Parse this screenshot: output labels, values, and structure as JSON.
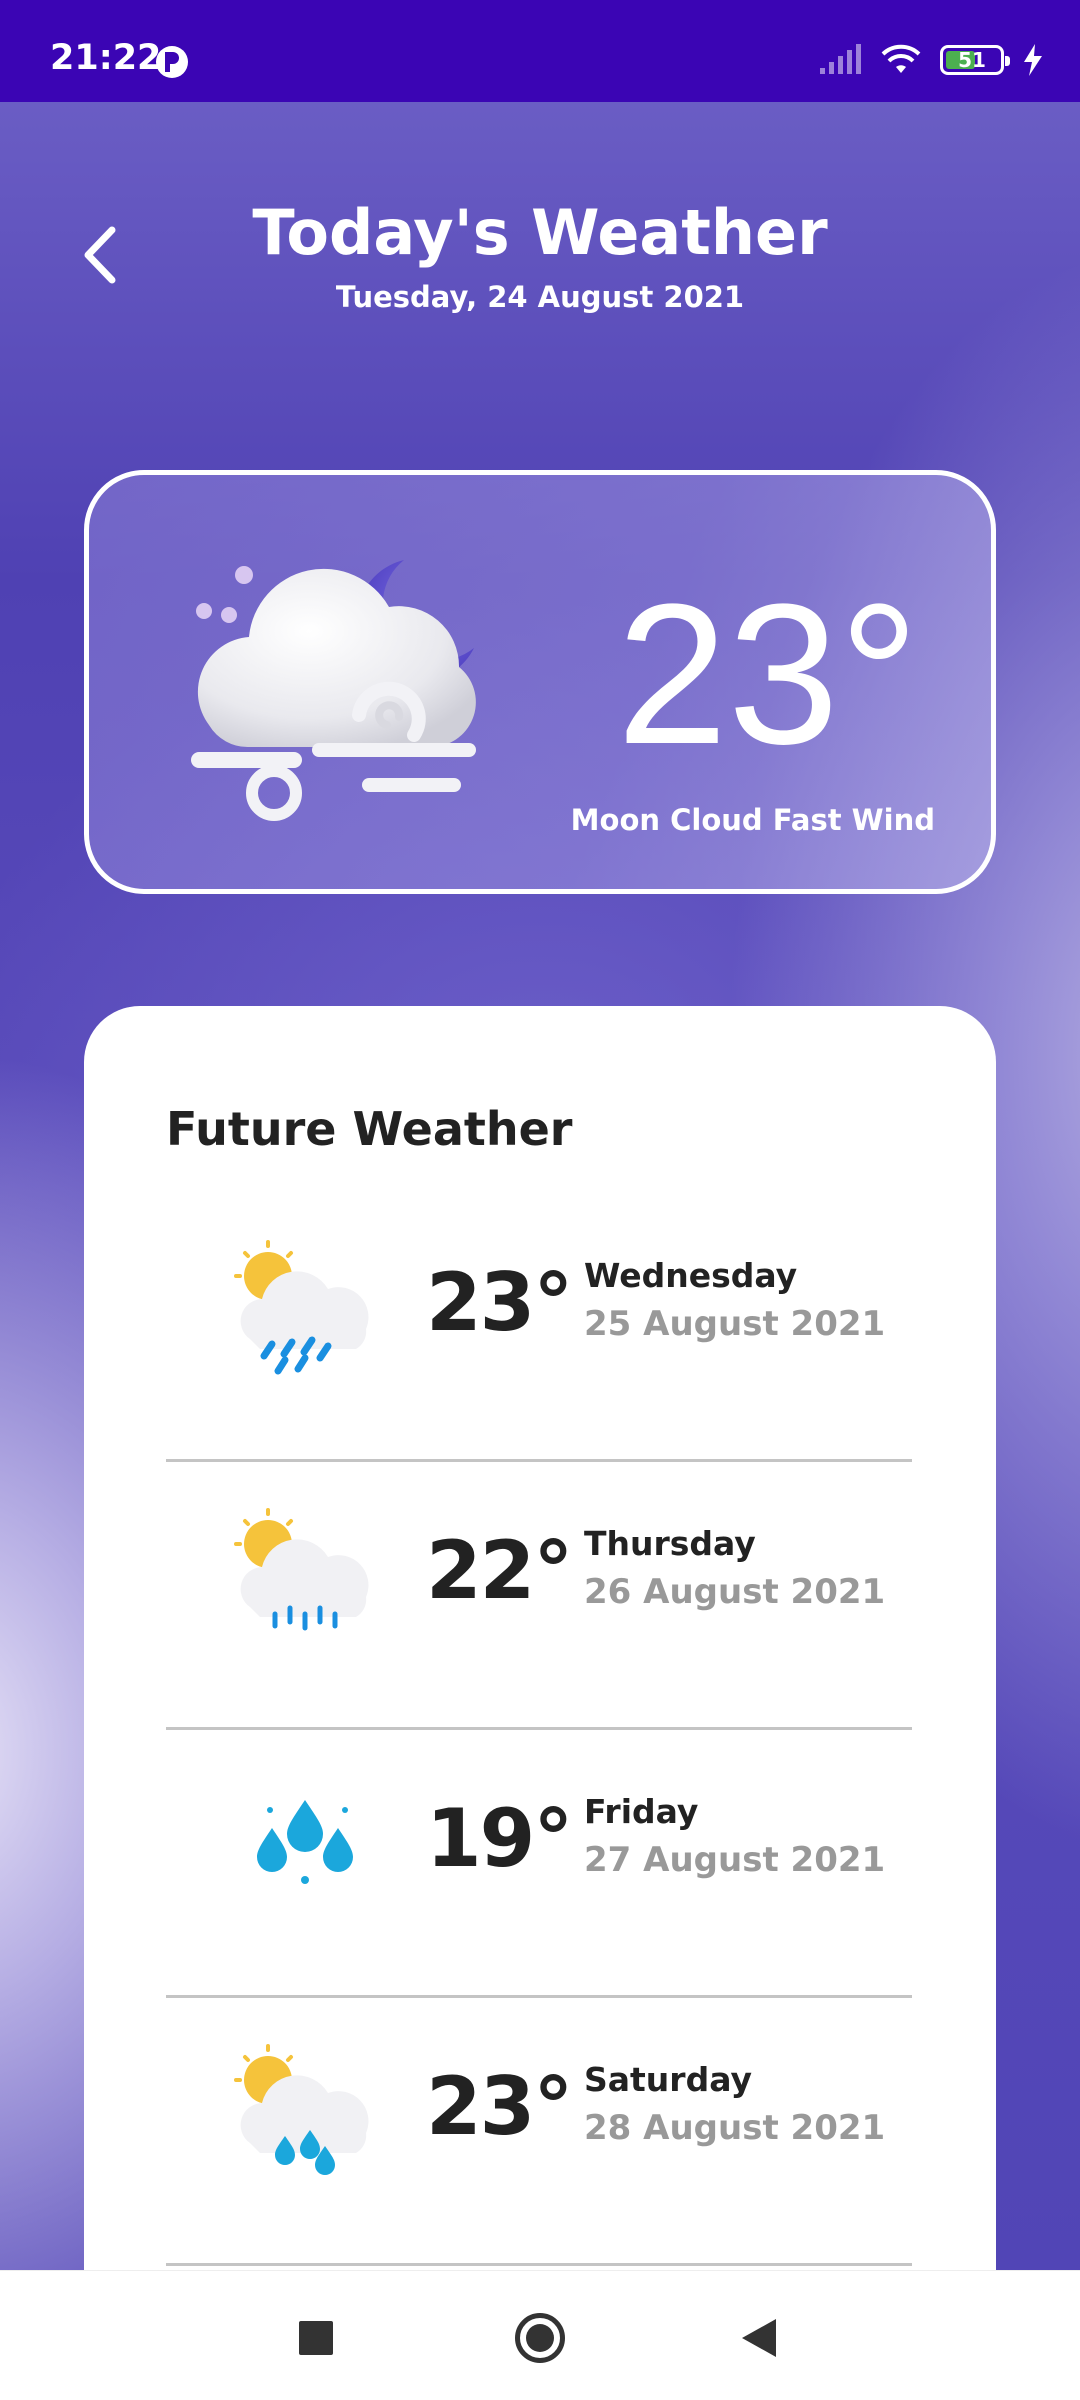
{
  "status_bar": {
    "time": "21:22",
    "battery_level": "51",
    "icons": [
      "cellular-signal-icon",
      "wifi-icon",
      "battery-icon",
      "charging-bolt-icon"
    ]
  },
  "header": {
    "title": "Today's Weather",
    "date": "Tuesday, 24 August 2021",
    "back_icon": "chevron-left-icon"
  },
  "current": {
    "temperature": "23°",
    "condition": "Moon Cloud Fast Wind",
    "icon": "moon-cloud-wind-icon"
  },
  "future": {
    "title": "Future Weather",
    "days": [
      {
        "temp": "23°",
        "day": "Wednesday",
        "date": "25 August 2021",
        "icon": "sun-cloud-rain-icon"
      },
      {
        "temp": "22°",
        "day": "Thursday",
        "date": "26 August 2021",
        "icon": "sun-cloud-drizzle-icon"
      },
      {
        "temp": "19°",
        "day": "Friday",
        "date": "27 August 2021",
        "icon": "raindrops-icon"
      },
      {
        "temp": "23°",
        "day": "Saturday",
        "date": "28 August 2021",
        "icon": "sun-cloud-drops-icon"
      }
    ]
  },
  "nav_bar": {
    "icons": [
      "recents-square-icon",
      "home-circle-icon",
      "back-triangle-icon"
    ]
  },
  "colors": {
    "status_bar": "#3b05b4",
    "background": "#5447b8",
    "card_border": "#ffffff",
    "text_dark": "#222222",
    "text_muted": "#999999"
  }
}
